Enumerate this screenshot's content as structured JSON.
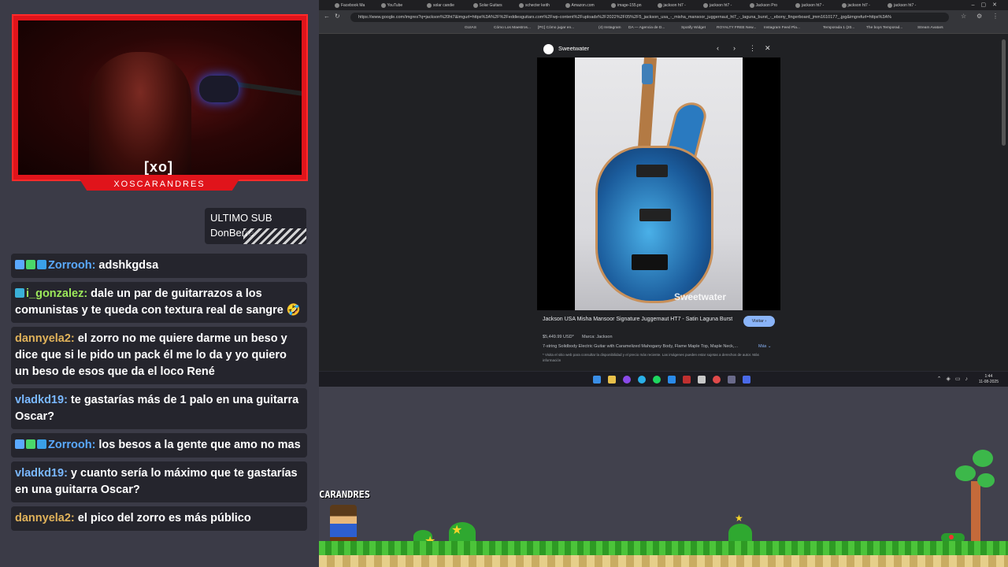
{
  "overlay": {
    "cam_logo": "[xo]",
    "cam_name": "XOSCARANDRES",
    "last_sub_label": "ULTIMO SUB",
    "last_sub_name": "DonBerre"
  },
  "chat": [
    {
      "user": "Zorrooh:",
      "user_color": "#5aa9ff",
      "badges": [
        "sword",
        "gem",
        "cube"
      ],
      "text": "adshkgdsa"
    },
    {
      "user": "i_gonzalez:",
      "user_color": "#9ce85a",
      "badges": [
        "grid"
      ],
      "text": "dale un par de guitarrazos a los comunistas y te queda con textura real de sangre 🤣"
    },
    {
      "user": "dannyela2:",
      "user_color": "#e0b25a",
      "badges": [],
      "text": "el zorro no me quiere darme un beso y dice que si le pido un pack él me lo da y yo quiero un beso de esos que da el loco René"
    },
    {
      "user": "vladkd19:",
      "user_color": "#7ab8ff",
      "badges": [],
      "text": "te gastarías más de 1 palo en una guitarra Oscar?"
    },
    {
      "user": "Zorrooh:",
      "user_color": "#5aa9ff",
      "badges": [
        "sword",
        "gem",
        "cube"
      ],
      "text": "los besos a la gente que amo no mas"
    },
    {
      "user": "vladkd19:",
      "user_color": "#7ab8ff",
      "badges": [],
      "text": "y cuanto sería lo máximo que te gastarías en una guitarra Oscar?"
    },
    {
      "user": "dannyela2:",
      "user_color": "#e0b25a",
      "badges": [],
      "text": "el pico del zorro es más público"
    }
  ],
  "browser": {
    "tabs": [
      "Facebook Ma",
      "YouTube",
      "solar candie",
      "Solar Guitars",
      "schecter keith",
      "Amazon.com",
      "image-155.pn",
      "jackson ht7 -",
      "jackson ht7 -",
      "Jackson Pro",
      "jackson ht7 -",
      "jackson ht7 -",
      "jackson ht7 -"
    ],
    "url": "https://www.google.com/imgres?q=jackson%20ht7&imgurl=https%3A%2F%2Feddiesguitars.com%2Fwp-content%2Fuploads%2F2022%2F05%2F5_jackson_usa_-_misha_mansoor_juggernaut_ht7_-_laguna_burst_-_ebony_fingerboard_jmm1610177_.jpg&imgrefurl=https%3A%",
    "bookmarks": [
      "GUIAS",
      "Cómo Los Maestros...",
      "[PC] Cómo jugar en...",
      "(4) Instagram",
      "DA — Agencia de D...",
      "Spotify Widget",
      "ROYALTY FREE New...",
      "Instagram Feed Pla...",
      "Temporada 1 (20...",
      "The boys Temporad...",
      "Stream Avatars"
    ]
  },
  "viewer": {
    "source": "Sweetwater",
    "watermark": "Sweetwater",
    "title": "Jackson USA Misha Mansoor Signature Juggernaut HT7 - Satin Laguna Burst",
    "visit_label": "Visitar ›",
    "price": "$5,449.99 USD*",
    "brand": "Marca: Jackson",
    "description": "7-string Solidbody Electric Guitar with Caramelized Mahogany Body, Flame Maple Top, Maple Neck,...",
    "more_label": "Más ⌄",
    "disclaimer": "* Visita el sitio web para consultar la disponibilidad y el precio más reciente. Las imágenes pueden estar sujetas a derechos de autor. Más información"
  },
  "taskbar": {
    "time": "1:44",
    "date": "11-08-2025"
  },
  "game": {
    "name_tag": "CARANDRES"
  },
  "colors": {
    "cam_frame": "#e0141b",
    "chat_bg": "#25252d",
    "overlay_bg": "#3b3b47",
    "browser_bg": "#202124",
    "visit_button": "#8ab4f8"
  }
}
